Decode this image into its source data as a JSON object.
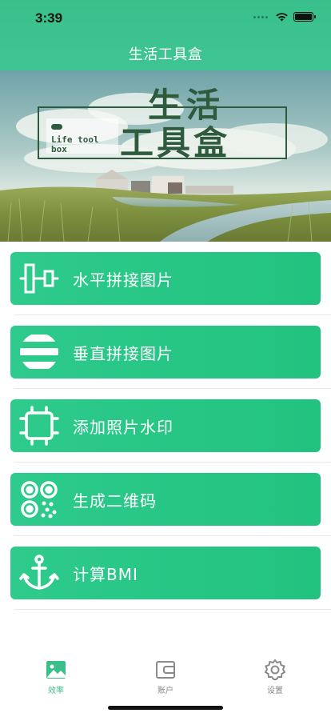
{
  "status": {
    "time": "3:39"
  },
  "nav": {
    "title": "生活工具盒"
  },
  "banner": {
    "title_line1": "生活",
    "title_line2": "工具盒",
    "subtitle_line1": "Life tool",
    "subtitle_line2": "box"
  },
  "tools": [
    {
      "label": "水平拼接图片",
      "icon": "horizontal-stitch-icon"
    },
    {
      "label": "垂直拼接图片",
      "icon": "vertical-stitch-icon"
    },
    {
      "label": "添加照片水印",
      "icon": "watermark-crop-icon"
    },
    {
      "label": "生成二维码",
      "icon": "qr-code-icon"
    },
    {
      "label": "计算BMI",
      "icon": "anchor-icon"
    }
  ],
  "tabs": [
    {
      "label": "效率",
      "icon": "picture-icon",
      "active": true
    },
    {
      "label": "账户",
      "icon": "wallet-icon",
      "active": false
    },
    {
      "label": "设置",
      "icon": "gear-icon",
      "active": false
    }
  ],
  "colors": {
    "brand": "#3ec594",
    "button": "#28c786",
    "tab_active": "#3bbf8a"
  }
}
